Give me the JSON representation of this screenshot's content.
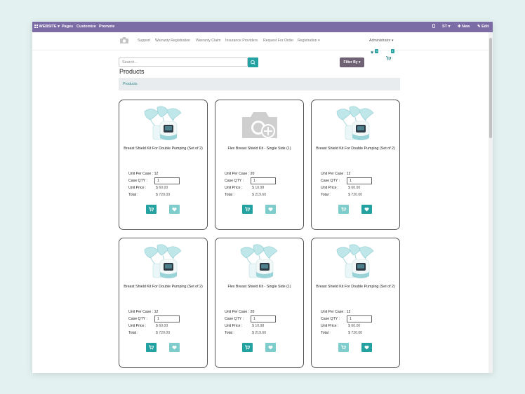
{
  "topbar": {
    "website": "WEBSITE",
    "pages": "Pages",
    "customize": "Customize",
    "promote": "Promote",
    "st": "ST",
    "new": "New",
    "edit": "Edit"
  },
  "nav": {
    "items": [
      "Support",
      "Warranty Registration",
      "Warranty Claim",
      "Insurance Providers",
      "Request For Order",
      "Registration"
    ],
    "user": "Administrator",
    "wishlist_count": "0",
    "cart_count": "1"
  },
  "search": {
    "placeholder": "Search..."
  },
  "filter": {
    "label": "Filter By"
  },
  "page_title": "Products",
  "breadcrumb": "Products",
  "labels": {
    "unit_per_case": "Unit Per Case :",
    "case_qty": "Case QTY :",
    "unit_price": "Unit Price :",
    "total": "Total :"
  },
  "products": [
    {
      "name": "Breast Shield Kit For Double Pumping (Set of 2)",
      "unit_per_case": "12",
      "qty": "1",
      "unit_price": "$ 60.00",
      "total": "$ 720.00",
      "image": "breast-pump",
      "cart_light": false,
      "wish_dark": false
    },
    {
      "name": "Flex Breast Shield Kit - Single Side (1)",
      "unit_per_case": "20",
      "qty": "1",
      "unit_price": "$ 10.98",
      "total": "$ 219.60",
      "image": "placeholder-camera",
      "cart_light": false,
      "wish_dark": false
    },
    {
      "name": "Breast Shield Kit For Double Pumping (Set of 2)",
      "unit_per_case": "12",
      "qty": "1",
      "unit_price": "$ 60.00",
      "total": "$ 720.00",
      "image": "breast-pump",
      "cart_light": true,
      "wish_dark": true
    },
    {
      "name": "Breast Shield Kit For Double Pumping (Set of 2)",
      "unit_per_case": "12",
      "qty": "1",
      "unit_price": "$ 60.00",
      "total": "$ 720.00",
      "image": "breast-pump",
      "cart_light": false,
      "wish_dark": false
    },
    {
      "name": "Flex Breast Shield Kit - Single Side (1)",
      "unit_per_case": "20",
      "qty": "1",
      "unit_price": "$ 10.98",
      "total": "$ 219.60",
      "image": "breast-pump-flex",
      "cart_light": false,
      "wish_dark": false
    },
    {
      "name": "Breast Shield Kit For Double Pumping (Set of 2)",
      "unit_per_case": "12",
      "qty": "1",
      "unit_price": "$ 60.00",
      "total": "$ 720.00",
      "image": "breast-pump",
      "cart_light": true,
      "wish_dark": true
    }
  ],
  "colors": {
    "topbar": "#7c6ca6",
    "accent": "#24a1a1",
    "accent_light": "#7ecccc",
    "filter_btn": "#6f6275"
  }
}
